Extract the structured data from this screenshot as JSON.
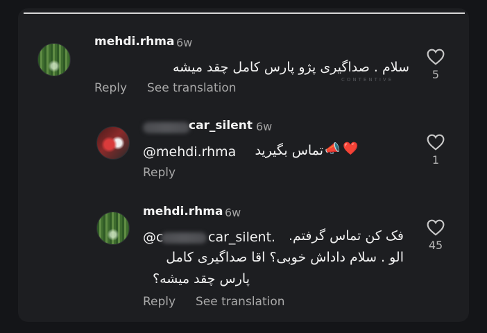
{
  "comments": [
    {
      "username": "mehdi.rhma",
      "time": "6w",
      "text": "سلام . صداگیری پژو پارس کامل چقد میشه",
      "watermark": "CONTENTIVE",
      "reply_label": "Reply",
      "translate_label": "See translation",
      "likes": "5"
    },
    {
      "username": "car_silent",
      "time": "6w",
      "mention": "@mehdi.rhma",
      "text": "تماس بگیرید",
      "emoji": "❤️",
      "reply_label": "Reply",
      "likes": "1"
    },
    {
      "username": "mehdi.rhma",
      "time": "6w",
      "mention_prefix": "@c",
      "mention_suffix": "car_silent.",
      "line1": "فک کن تماس گرفتم.",
      "line2": "الو . سلام داداش خوبی؟ اقا صداگیری کامل",
      "line3": "پارس چقد میشه؟",
      "reply_label": "Reply",
      "translate_label": "See translation",
      "likes": "45"
    }
  ]
}
